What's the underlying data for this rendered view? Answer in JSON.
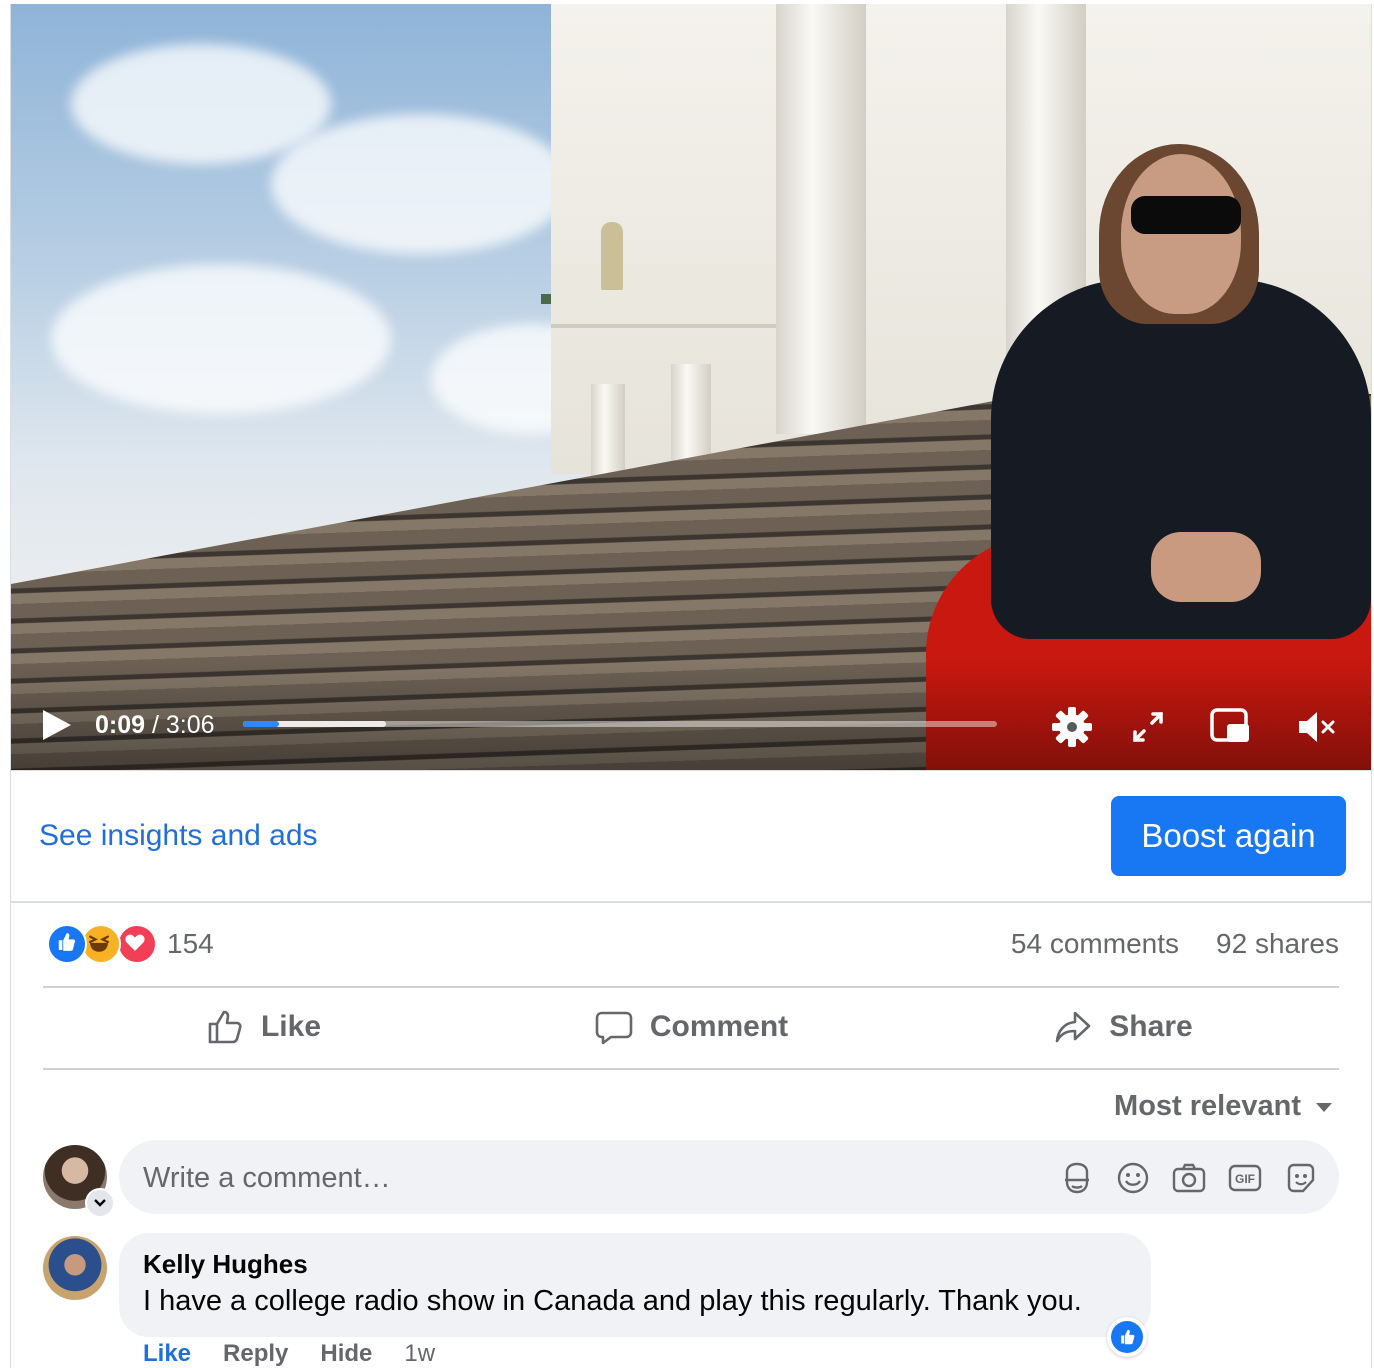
{
  "video": {
    "current_time": "0:09",
    "separator": " / ",
    "duration": "3:06",
    "progress_fraction": 0.048,
    "buffered_fraction": 0.19,
    "controls": [
      "play-icon",
      "settings-gear-icon",
      "fullscreen-icon",
      "picture-in-picture-icon",
      "muted-speaker-icon"
    ]
  },
  "promo": {
    "insights_link": "See insights and ads",
    "boost_button": "Boost again"
  },
  "stats": {
    "reaction_icons": [
      "like-reaction-icon",
      "haha-reaction-icon",
      "love-reaction-icon"
    ],
    "reaction_count": "154",
    "comments": "54 comments",
    "shares": "92 shares"
  },
  "actions": {
    "like": "Like",
    "comment": "Comment",
    "share": "Share"
  },
  "comments": {
    "sort_label": "Most relevant",
    "input_placeholder": "Write a comment…",
    "input_icons": [
      "avatar-sticker-icon",
      "emoji-icon",
      "camera-icon",
      "gif-icon",
      "sticker-icon"
    ],
    "items": [
      {
        "author": "Kelly Hughes",
        "text": "I have a college radio show in Canada and play this regularly. Thank you.",
        "actions": {
          "like": "Like",
          "reply": "Reply",
          "hide": "Hide"
        },
        "time_ago": "1w",
        "liked": true
      }
    ]
  },
  "colors": {
    "brand_blue": "#1877f2",
    "link_blue": "#216fdb",
    "secondary_text": "#65676b",
    "bubble_bg": "#f0f2f5"
  }
}
